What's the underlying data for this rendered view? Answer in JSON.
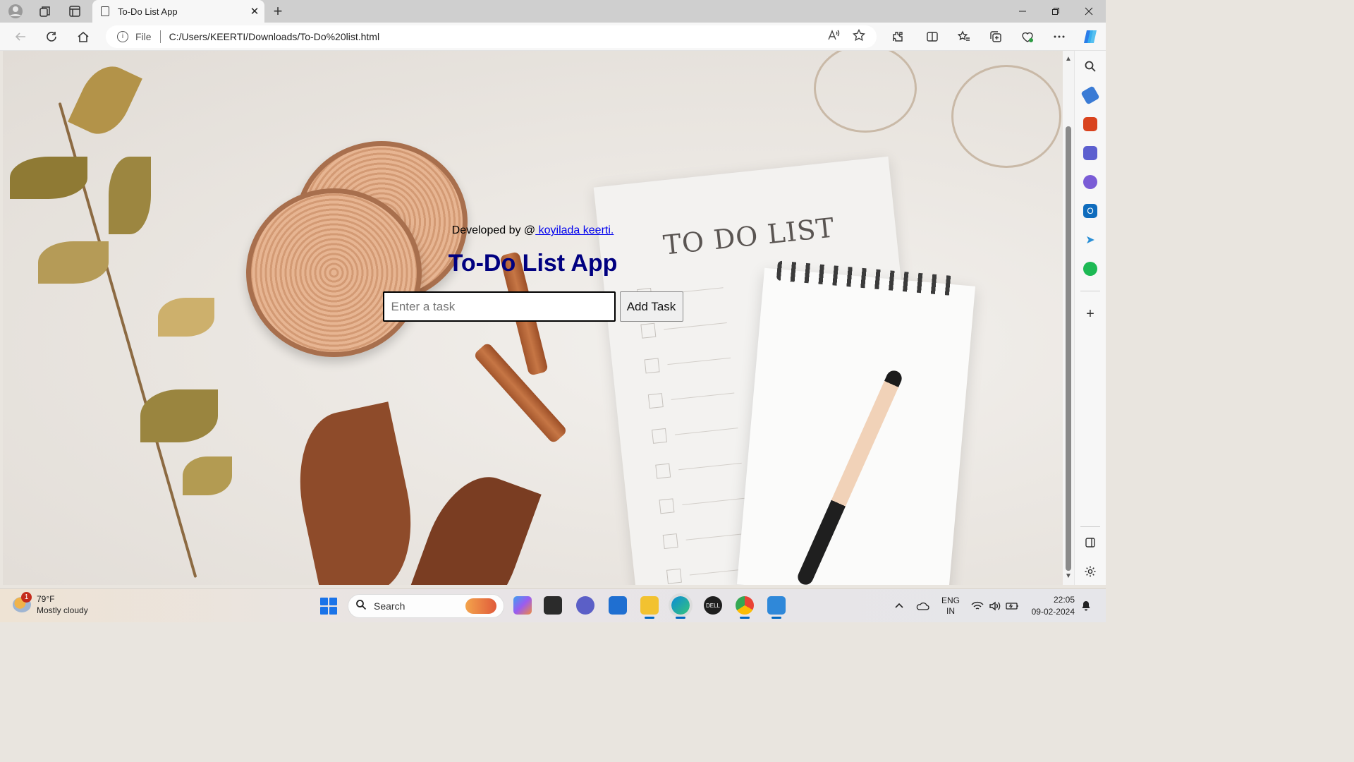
{
  "browser": {
    "tab_title": "To-Do List App",
    "tab_close": "✕",
    "new_tab": "+",
    "address_scheme": "File",
    "url": "C:/Users/KEERTI/Downloads/To-Do%20list.html"
  },
  "page": {
    "developed_by_prefix": "Developed by @",
    "developer_link": " koyilada keerti.",
    "title": "To-Do List App",
    "task_input": {
      "placeholder": "Enter a task",
      "value": ""
    },
    "add_button": "Add Task",
    "background_note_title": "TO DO LIST"
  },
  "taskbar": {
    "weather": {
      "temperature": "79°F",
      "condition": "Mostly cloudy",
      "badge": "1"
    },
    "search_label": "Search",
    "language": "ENG",
    "region": "IN",
    "time": "22:05",
    "date": "09-02-2024"
  },
  "colors": {
    "title": "#000080",
    "link": "#0000ee",
    "accent": "#0067c0"
  }
}
